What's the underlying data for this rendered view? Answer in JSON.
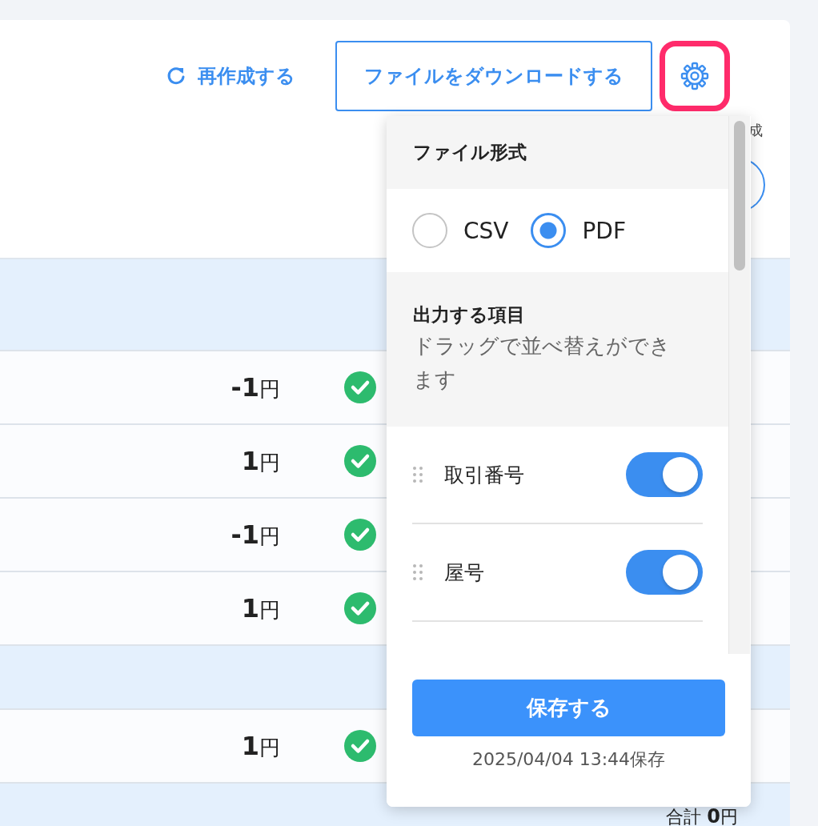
{
  "toolbar": {
    "regenerate": "再作成する",
    "download": "ファイルをダウンロードする",
    "settings_highlighted": true
  },
  "side_label": "成",
  "table": {
    "rows": [
      {
        "kind": "group"
      },
      {
        "kind": "row",
        "amount": "**-1**円",
        "done": true
      },
      {
        "kind": "row",
        "amount": "**1**円",
        "done": true
      },
      {
        "kind": "row",
        "amount": "**-1**円",
        "done": true
      },
      {
        "kind": "row",
        "amount": "**1**円",
        "done": true
      },
      {
        "kind": "group"
      },
      {
        "kind": "row",
        "amount": "**1**円",
        "done": true
      }
    ],
    "total": "合計 **0**円"
  },
  "popup": {
    "format": {
      "title": "ファイル形式",
      "options": [
        {
          "label": "CSV",
          "selected": false
        },
        {
          "label": "PDF",
          "selected": true
        }
      ]
    },
    "fields": {
      "title": "出力する項目",
      "hint": "ドラッグで並べ替えができます",
      "items": [
        {
          "label": "取引番号",
          "on": true
        },
        {
          "label": "屋号",
          "on": true
        }
      ]
    },
    "save_button": "保存する",
    "saved_at": "2025/04/04 13:44保存"
  }
}
